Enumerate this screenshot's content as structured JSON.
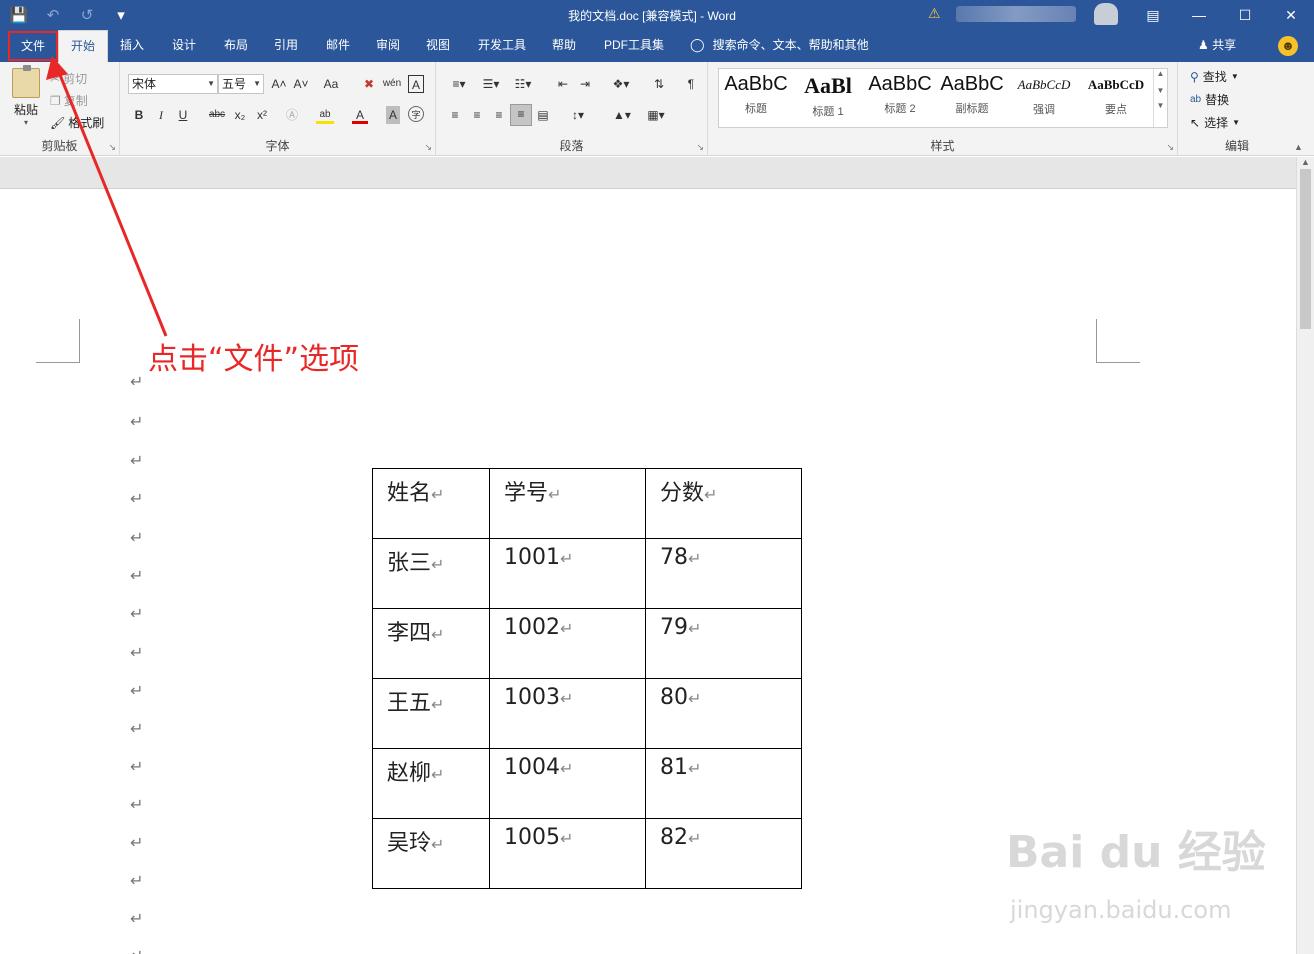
{
  "window": {
    "title": "我的文档.doc [兼容模式]  -  Word",
    "qat_icons": [
      "save-icon",
      "undo-icon",
      "redo-icon",
      "customize-icon"
    ]
  },
  "tabs": [
    "文件",
    "开始",
    "插入",
    "设计",
    "布局",
    "引用",
    "邮件",
    "审阅",
    "视图",
    "开发工具",
    "帮助",
    "PDF工具集"
  ],
  "active_tab": "开始",
  "tell_me": "搜索命令、文本、帮助和其他",
  "share": "共享",
  "clipboard": {
    "paste": "粘贴",
    "cut": "剪切",
    "copy": "复制",
    "format_painter": "格式刷",
    "label": "剪贴板"
  },
  "font": {
    "name": "宋体",
    "size": "五号",
    "label": "字体",
    "bold": "B",
    "italic": "I",
    "underline": "U",
    "strike": "abc",
    "sub": "x₂",
    "sup": "x²",
    "grow": "A˄",
    "shrink": "A˅",
    "case": "Aa",
    "phonetic": "wén",
    "border_char": "A",
    "font_color": "A",
    "highlight": "ab",
    "shading": "A",
    "enclose": "字"
  },
  "paragraph": {
    "label": "段落"
  },
  "styles": {
    "label": "样式",
    "items": [
      {
        "preview": "AaBbC",
        "name": "标题"
      },
      {
        "preview": "AaBl",
        "name": "标题 1"
      },
      {
        "preview": "AaBbC",
        "name": "标题 2"
      },
      {
        "preview": "AaBbC",
        "name": "副标题"
      },
      {
        "preview": "AaBbCcD",
        "name": "强调"
      },
      {
        "preview": "AaBbCcD",
        "name": "要点"
      }
    ]
  },
  "editing": {
    "label": "编辑",
    "find": "查找",
    "replace": "替换",
    "select": "选择"
  },
  "annotation": "点击“文件”选项",
  "table": {
    "rows": [
      [
        "姓名",
        "学号",
        "分数"
      ],
      [
        "张三",
        "",
        "78"
      ],
      [
        "李四",
        "1002",
        "79"
      ],
      [
        "王五",
        "1003",
        "80"
      ],
      [
        "赵柳",
        "1004",
        "81"
      ],
      [
        "吴玲",
        "1005",
        "82"
      ]
    ],
    "row2_id": "1001"
  },
  "para_mark": "↵",
  "watermark": {
    "logo": "Bai du 经验",
    "url": "jingyan.baidu.com"
  }
}
